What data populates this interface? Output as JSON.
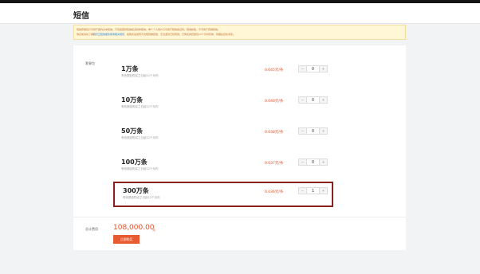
{
  "page": {
    "title": "短信"
  },
  "notice": {
    "line1": "短信套餐包只可用于国内文本短信；不包括国际短信和多媒体短信；单个个人用户只可用于短信验证码，短信模板，不可用于营销短信；",
    "line2_prefix": "购买前请先了解",
    "line2_link": "腾讯云短信服务使用相关规范",
    "line2_suffix": "，如购买后发现不合规则被拒绝，无法退款已扣费用；已购买的套餐包12个月内有效，到期后自动清零。"
  },
  "packages": {
    "label": "套餐包",
    "items": [
      {
        "name": "1万条",
        "desc": "有效期自购买之日起12个月内",
        "price": "0.045元/条",
        "qty": "0",
        "selected": false
      },
      {
        "name": "10万条",
        "desc": "有效期自购买之日起12个月内",
        "price": "0.040元/条",
        "qty": "0",
        "selected": false
      },
      {
        "name": "50万条",
        "desc": "有效期自购买之日起12个月内",
        "price": "0.038元/条",
        "qty": "0",
        "selected": false
      },
      {
        "name": "100万条",
        "desc": "有效期自购买之日起12个月内",
        "price": "0.037元/条",
        "qty": "0",
        "selected": false
      },
      {
        "name": "300万条",
        "desc": "有效期自购买之日起12个月内",
        "price": "0.036元/条",
        "qty": "1",
        "selected": true
      }
    ],
    "minus_symbol": "−",
    "plus_symbol": "+"
  },
  "total": {
    "label": "总计费用",
    "value": "108,000.00",
    "unit": "元",
    "buy_label": "立即购买"
  },
  "colors": {
    "accent": "#e0502a",
    "selected_border": "#8b1f1f",
    "button": "#e85a30"
  }
}
